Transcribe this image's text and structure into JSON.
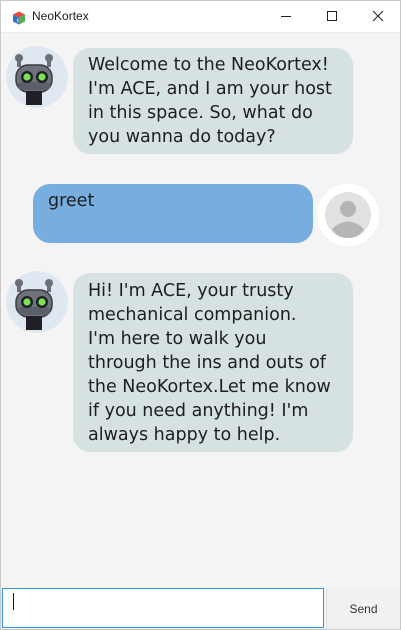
{
  "window": {
    "title": "NeoKortex",
    "icon": "app-cube-icon",
    "controls": [
      "minimize-icon",
      "maximize-icon",
      "close-icon"
    ]
  },
  "messages": [
    {
      "sender": "bot",
      "avatar": "robot-avatar-icon",
      "text": "Welcome to the NeoKortex!\nI'm ACE, and I am your host\nin this space. So, what do\nyou wanna do today?"
    },
    {
      "sender": "user",
      "avatar": "user-avatar-icon",
      "text": "greet"
    },
    {
      "sender": "bot",
      "avatar": "robot-avatar-icon",
      "text": "Hi! I'm ACE, your trusty\nmechanical companion.\nI'm here to walk you\nthrough the ins and outs of\nthe NeoKortex.Let me know\nif you need anything! I'm\nalways happy to help."
    }
  ],
  "input": {
    "value": "",
    "placeholder": ""
  },
  "send_button": {
    "label": "Send"
  },
  "colors": {
    "bot_bubble": "#d6e1e1",
    "user_bubble": "#77aedf",
    "background": "#f4f4f4",
    "input_focus_border": "#3c93d3"
  }
}
